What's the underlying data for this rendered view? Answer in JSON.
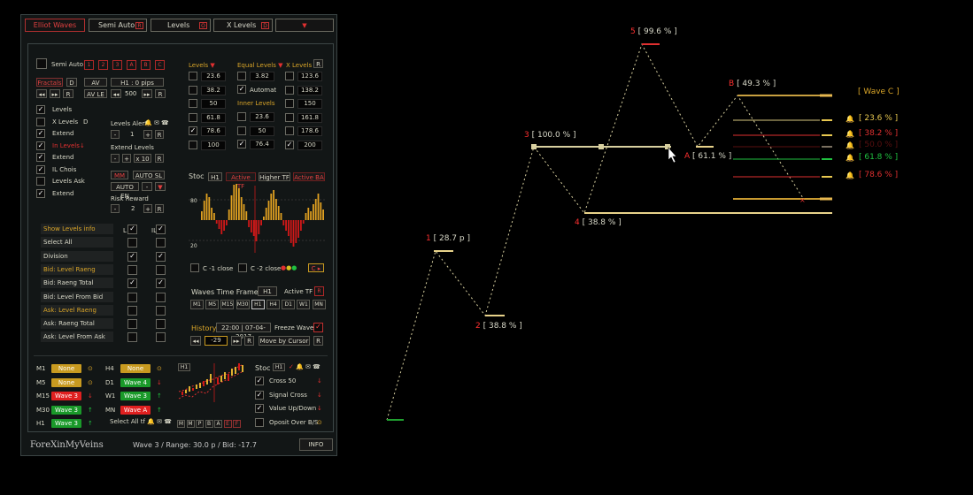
{
  "tabs": [
    {
      "label": "Elliot Waves",
      "active": true
    },
    {
      "label": "Semi Auto",
      "badge": "R"
    },
    {
      "label": "Levels",
      "badge": "O"
    },
    {
      "label": "X Levels",
      "badge": "D"
    }
  ],
  "semi_auto": {
    "label": "Semi Auto",
    "wave_buttons": [
      "1",
      "2",
      "3",
      "A",
      "B",
      "C"
    ]
  },
  "fractals": {
    "label": "Fractals",
    "d": "D",
    "av": "AV",
    "tf_pips": "H1 : 0  pips",
    "av_le": "AV LE",
    "value": "500",
    "r": "R"
  },
  "left_checks": [
    {
      "label": "Levels",
      "checked": true,
      "red": false
    },
    {
      "label": "X Levels",
      "checked": false,
      "red": false,
      "extra": "D"
    },
    {
      "label": "Extend",
      "checked": true,
      "red": false
    },
    {
      "label": "In Levels",
      "checked": true,
      "red": true
    },
    {
      "label": "Extend",
      "checked": true,
      "red": false
    },
    {
      "label": "IL Chois",
      "checked": true,
      "red": false
    },
    {
      "label": "Levels Ask",
      "checked": false,
      "red": false
    },
    {
      "label": "Extend",
      "checked": true,
      "red": false
    }
  ],
  "levels_alert": {
    "label": "Levels Alert",
    "value": "1",
    "r": "R"
  },
  "extend_levels": {
    "label": "Extend Levels",
    "value": "x 10",
    "r": "R"
  },
  "mm": {
    "mm": "MM",
    "auto_sl": "AUTO SL",
    "auto_en": "AUTO EN"
  },
  "risk_reward": {
    "label": "Risk Reward",
    "value": "2",
    "r": "R"
  },
  "levels_col": {
    "header": "Levels",
    "values": [
      "23.6",
      "38.2",
      "50",
      "61.8",
      "78.6",
      "100"
    ],
    "checks": [
      false,
      false,
      false,
      false,
      true,
      false
    ]
  },
  "equal_col": {
    "header": "Equal Levels",
    "top_value": "3.82",
    "automat": "Automat",
    "inner_label": "Inner Levels",
    "values": [
      "23.6",
      "50",
      "76.4"
    ],
    "checks": [
      false,
      false,
      true
    ]
  },
  "x_col": {
    "header": "X Levels",
    "r": "R",
    "values": [
      "123.6",
      "138.2",
      "150",
      "161.8",
      "178.6",
      "200"
    ],
    "checks": [
      false,
      false,
      false,
      false,
      false,
      true
    ]
  },
  "list_rows": [
    {
      "label": "Show Levels info",
      "gold": true,
      "l": true,
      "il": true
    },
    {
      "label": "Select All",
      "gold": false,
      "l": false,
      "il": false
    },
    {
      "label": "Division",
      "gold": false,
      "l": true,
      "il": true
    },
    {
      "label": "Bid: Level Raeng",
      "gold": true,
      "l": false,
      "il": false
    },
    {
      "label": "Bid: Raeng Total",
      "gold": false,
      "l": true,
      "il": true
    },
    {
      "label": "Bid: Level From Bid",
      "gold": false,
      "l": false,
      "il": false
    },
    {
      "label": "Ask: Level Raeng",
      "gold": true,
      "l": false,
      "il": false
    },
    {
      "label": "Ask: Raeng Total",
      "gold": false,
      "l": false,
      "il": false
    },
    {
      "label": "Ask: Level From Ask",
      "gold": false,
      "l": false,
      "il": false
    }
  ],
  "list_headers": {
    "l": "L",
    "il": "IL"
  },
  "stoc": {
    "label": "Stoc",
    "tf": "H1",
    "active_tf": "Active TF",
    "higher_tf": "Higher TF",
    "active_ba": "Active BA",
    "lvl_hi": "80",
    "lvl_lo": "20",
    "c1": "C -1 close",
    "c2": "C -2 close"
  },
  "stoc_hist": [
    10,
    22,
    30,
    26,
    14,
    8,
    -4,
    -10,
    -16,
    -12,
    -6,
    12,
    28,
    40,
    44,
    36,
    26,
    18,
    10,
    -8,
    -14,
    -18,
    -24,
    -16,
    -6,
    4,
    14,
    22,
    30,
    34,
    24,
    16,
    8,
    -6,
    -12,
    -18,
    -26,
    -30,
    -26,
    -20,
    -12,
    -4,
    8,
    14,
    10,
    18,
    24,
    30,
    20,
    12
  ],
  "waves_tf": {
    "label": "Waves Time Frame",
    "tf": "H1",
    "active_tf": "Active TF",
    "r": "R",
    "buttons": [
      "M1",
      "M5",
      "M15",
      "M30",
      "H1",
      "H4",
      "D1",
      "W1",
      "MN"
    ]
  },
  "history": {
    "label": "History",
    "datetime": "22:00 | 07-04-2017",
    "freeze": "Freeze Waves",
    "value": "-29",
    "move": "Move by Cursor",
    "r": "R"
  },
  "tf_waves_left": [
    {
      "tf": "M1",
      "value": "None",
      "color": "#c89a20",
      "arrow": "⊙"
    },
    {
      "tf": "M5",
      "value": "None",
      "color": "#c89a20",
      "arrow": "⊙"
    },
    {
      "tf": "M15",
      "value": "Wave 3",
      "color": "#e02020",
      "arrow": "↓"
    },
    {
      "tf": "M30",
      "value": "Wave 3",
      "color": "#1a9a2a",
      "arrow": "↑"
    },
    {
      "tf": "H1",
      "value": "Wave 3",
      "color": "#1a9a2a",
      "arrow": "↑"
    }
  ],
  "tf_waves_right": [
    {
      "tf": "H4",
      "value": "None",
      "color": "#c89a20",
      "arrow": "⊙"
    },
    {
      "tf": "D1",
      "value": "Wave 4",
      "color": "#1a9a2a",
      "arrow": "↓"
    },
    {
      "tf": "W1",
      "value": "Wave 3",
      "color": "#1a9a2a",
      "arrow": "↑"
    },
    {
      "tf": "MN",
      "value": "Wave A",
      "color": "#e02020",
      "arrow": "↑"
    }
  ],
  "select_all_tf": "Select All tf",
  "mini_chart": {
    "tf": "H1",
    "buttons": [
      "M",
      "M",
      "P",
      "B",
      "A",
      "E",
      "F"
    ]
  },
  "stoc_signals": {
    "label": "Stoc",
    "tf": "H1",
    "items": [
      {
        "label": "Cross 50",
        "checked": true
      },
      {
        "label": "Signal Cross",
        "checked": true
      },
      {
        "label": "Value Up/Down",
        "checked": true
      },
      {
        "label": "Oposit Over B/S",
        "checked": false
      }
    ]
  },
  "footer": {
    "brand": "ForeXinMyVeins",
    "status": "Wave 3  /  Range: 30.0 p  /  Bid: -17.7",
    "info": "INFO"
  },
  "chart_labels": {
    "w1": "1",
    "w1v": "[ 28.7 p ]",
    "w2": "2",
    "w2v": "[ 38.8 % ]",
    "w3": "3",
    "w3v": "[ 100.0 % ]",
    "w4": "4",
    "w4v": "[ 38.8 % ]",
    "w5": "5",
    "w5v": "[ 99.6 % ]",
    "wa": "A",
    "wav": "[ 61.1 % ]",
    "wb": "B",
    "wbv": "[ 49.3 % ]",
    "wave_c": "[ Wave C ]"
  },
  "fib_levels": [
    {
      "label": "[ 23.6 % ]",
      "color": "#d8c880",
      "marker": "#e8c850"
    },
    {
      "label": "[ 38.2 % ]",
      "color": "#e03030",
      "marker": "#e8c850"
    },
    {
      "label": "[ 50.0 % ]",
      "color": "#5a1010",
      "marker": "#7a7060"
    },
    {
      "label": "[ 61.8 % ]",
      "color": "#20c040",
      "marker": "#20c040"
    },
    {
      "label": "[ 78.6 % ]",
      "color": "#e03030",
      "marker": "#e8c850"
    }
  ],
  "colors": {
    "accent": "#d8a428",
    "red": "#e03030",
    "green": "#20c040",
    "line": "#d8c890"
  }
}
